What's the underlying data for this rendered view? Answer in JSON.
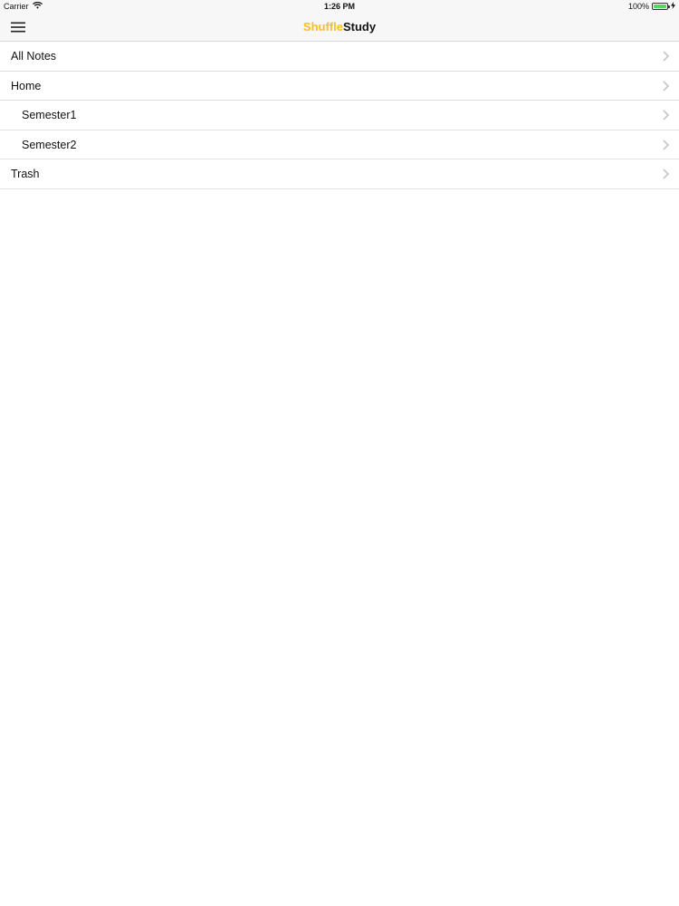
{
  "status_bar": {
    "carrier": "Carrier",
    "time": "1:26 PM",
    "battery_text": "100%",
    "battery_level": 1.0,
    "battery_color": "#4cd964",
    "wifi_icon": "wifi-icon",
    "charging_icon": "bolt-icon"
  },
  "nav_bar": {
    "title_accent": "Shuffle",
    "title_main": "Study",
    "accent_color": "#f5c218",
    "menu_icon": "hamburger-menu-icon"
  },
  "list": {
    "items": [
      {
        "label": "All Notes",
        "indent": 0
      },
      {
        "label": "Home",
        "indent": 0
      },
      {
        "label": "Semester1",
        "indent": 1
      },
      {
        "label": "Semester2",
        "indent": 1
      },
      {
        "label": "Trash",
        "indent": 0
      }
    ],
    "chevron_icon": "chevron-right-icon"
  }
}
